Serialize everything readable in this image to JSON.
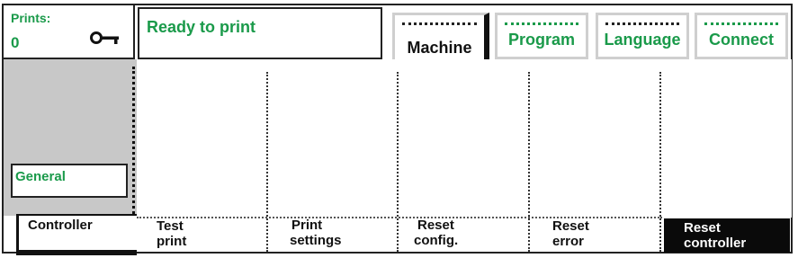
{
  "prints": {
    "label": "Prints:",
    "value": "0",
    "key_icon": "key-icon"
  },
  "status": {
    "text": "Ready to print"
  },
  "tabs": [
    {
      "label": "Machine",
      "active": true
    },
    {
      "label": "Program",
      "active": false
    },
    {
      "label": "Language",
      "active": false
    },
    {
      "label": "Connect",
      "active": false
    }
  ],
  "sidebar": {
    "selected_group": "General",
    "submenu": "Controller"
  },
  "softkeys": [
    {
      "line1": "Test",
      "line2": "print"
    },
    {
      "line1": "Print",
      "line2": "settings"
    },
    {
      "line1": "Reset",
      "line2": "config."
    },
    {
      "line1": "Reset",
      "line2": "error"
    },
    {
      "line1": "Reset",
      "line2": "controller",
      "selected": true
    }
  ],
  "colors": {
    "accent": "#1a9a4a",
    "frame": "#222222",
    "panel_gray": "#c8c8c8"
  }
}
